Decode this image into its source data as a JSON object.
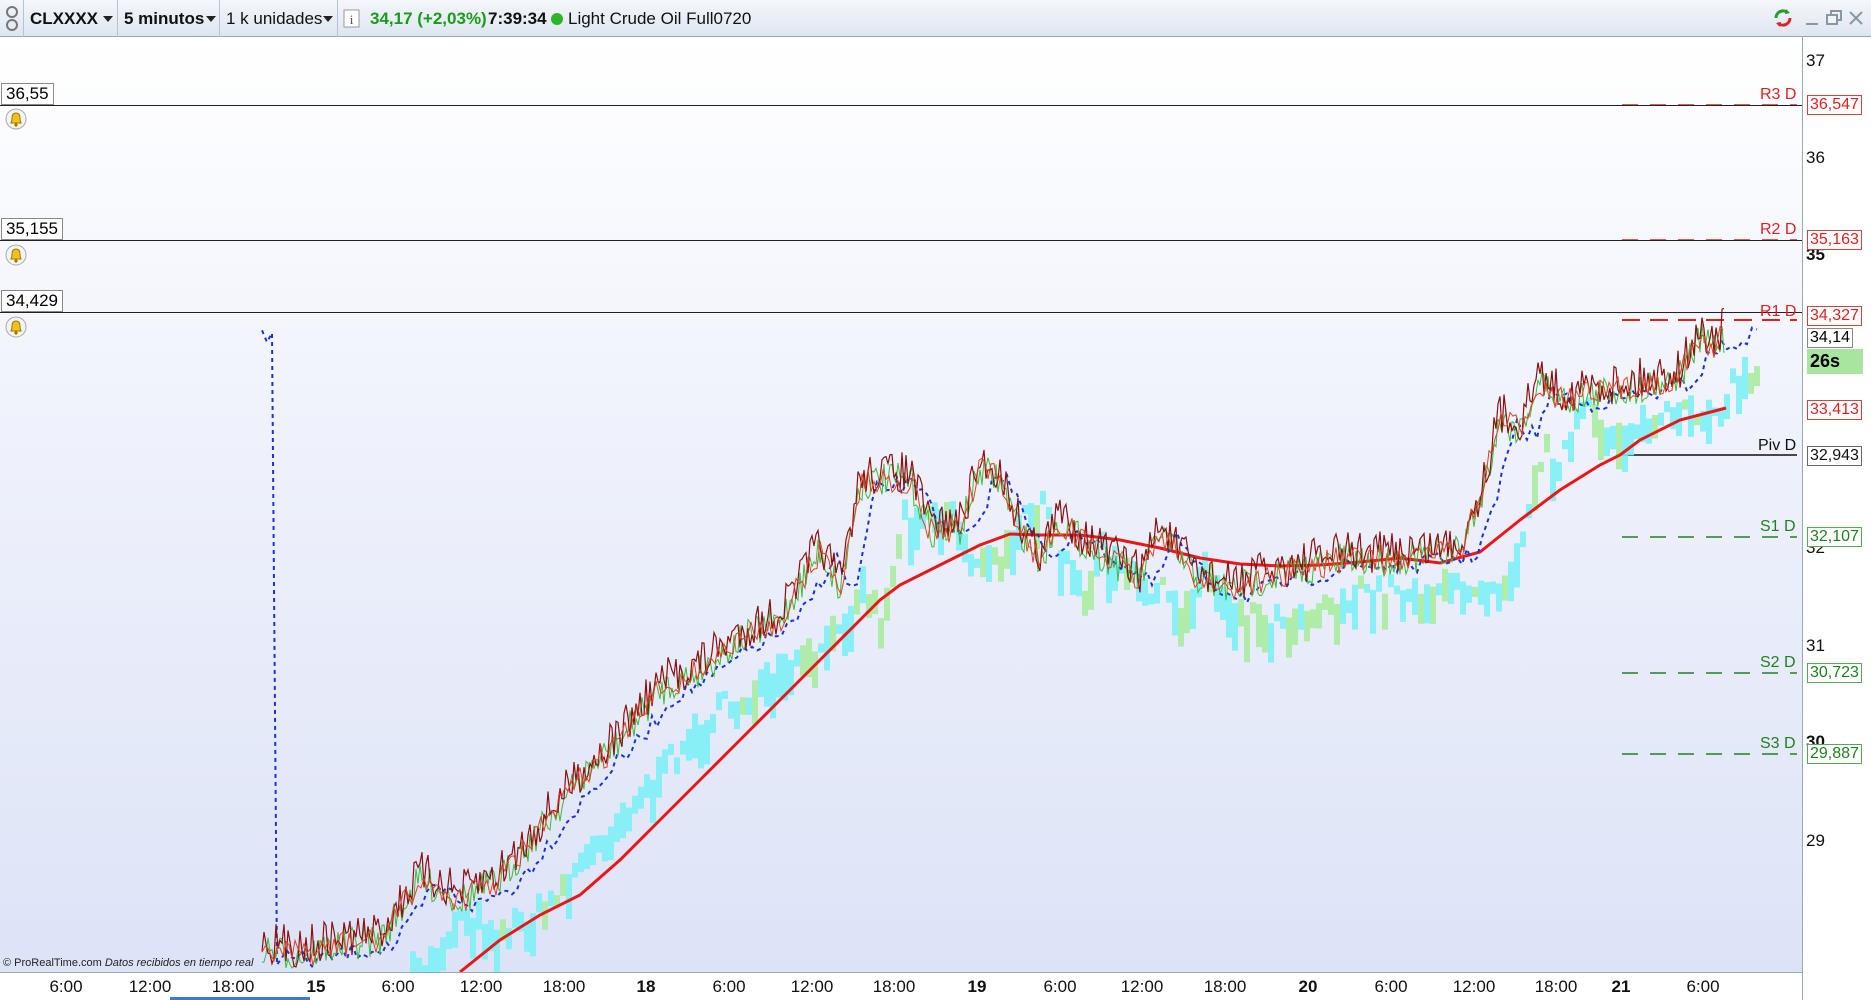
{
  "toolbar": {
    "symbol": "CLXXXX",
    "timeframe": "5 minutos",
    "units": "1 k unidades",
    "price_change": "34,17 (+2,03%)",
    "time": "7:39:34",
    "instrument": "Light Crude Oil Full0720"
  },
  "colors": {
    "resistance": "#e02020",
    "support": "#208020",
    "pivot": "#111111",
    "price_line": "#8b1010",
    "moving_average": "#e81818",
    "dashed_line": "#1a33cc",
    "cloud_bull": "#7ef0f6",
    "cloud_bear": "#a8eca0",
    "timer_bg": "#a8e6a0"
  },
  "alerts": [
    {
      "label": "36,55",
      "icon": "bell-icon"
    },
    {
      "label": "35,155",
      "icon": "bell-icon"
    },
    {
      "label": "34,429",
      "icon": "bell-icon"
    }
  ],
  "pivots": [
    {
      "name": "R3 D",
      "value": "36,547"
    },
    {
      "name": "R2 D",
      "value": "35,163"
    },
    {
      "name": "R1 D",
      "value": "34,327"
    },
    {
      "name": "Piv D",
      "value": "32,943"
    },
    {
      "name": "S1 D",
      "value": "32,107"
    },
    {
      "name": "S2 D",
      "value": "30,723"
    },
    {
      "name": "S3 D",
      "value": "29,887"
    }
  ],
  "price_axis": {
    "ticks": [
      "37",
      "36",
      "35",
      "32",
      "31",
      "30",
      "29"
    ],
    "extra_level": "33,413",
    "last_price": "34,14",
    "timer": "26s"
  },
  "time_axis": {
    "labels": [
      "6:00",
      "12:00",
      "18:00",
      "15",
      "6:00",
      "12:00",
      "18:00",
      "18",
      "6:00",
      "12:00",
      "18:00",
      "19",
      "6:00",
      "12:00",
      "18:00",
      "20",
      "6:00",
      "12:00",
      "18:00",
      "21",
      "6:00"
    ]
  },
  "footer": {
    "brand": "© ProRealTime.com",
    "note": "Datos recibidos en tiempo real"
  }
}
